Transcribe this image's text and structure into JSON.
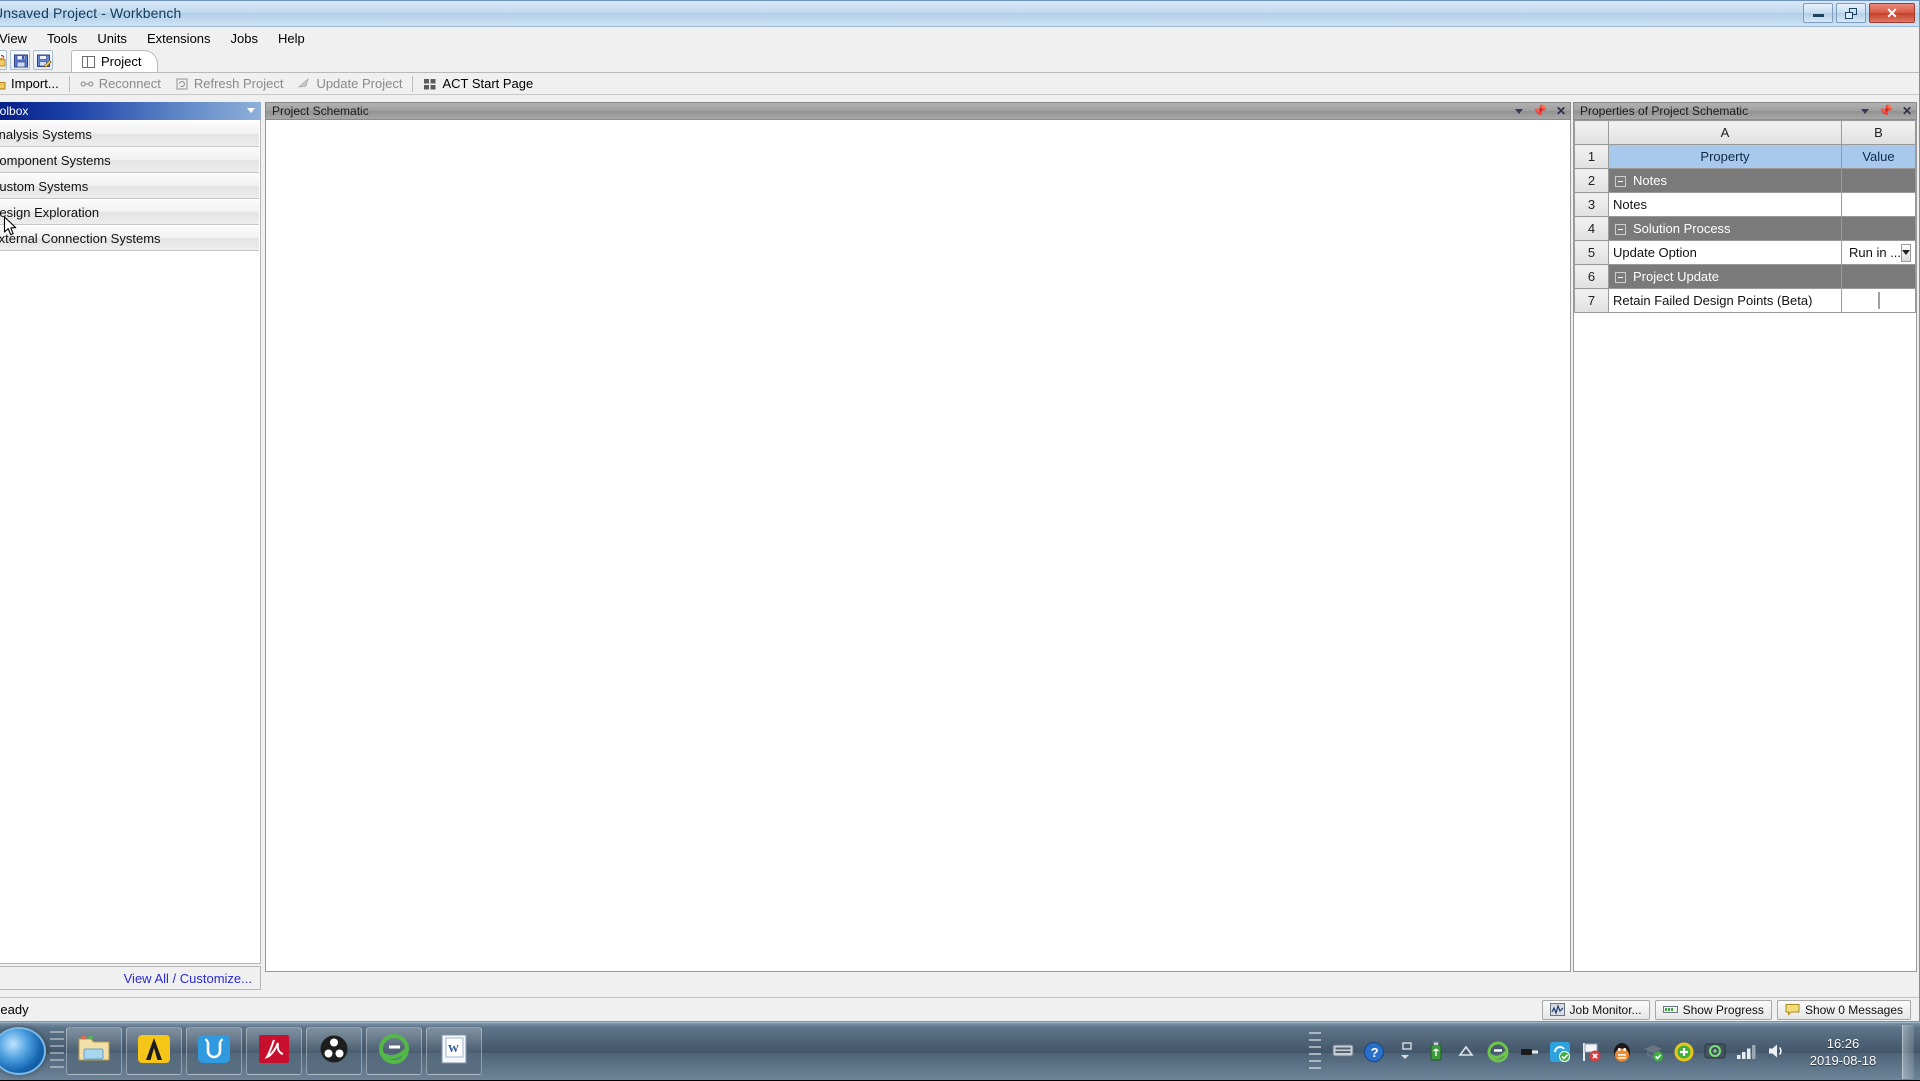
{
  "window": {
    "title": "Unsaved Project - Workbench",
    "controls": {
      "minimize": "minimize-button",
      "restore": "restore-button",
      "close": "close-button"
    }
  },
  "menu": {
    "items": [
      "View",
      "Tools",
      "Units",
      "Extensions",
      "Jobs",
      "Help"
    ]
  },
  "quick_toolbar": {
    "icons": [
      "open-folder-icon",
      "save-icon",
      "save-as-icon"
    ]
  },
  "tabs": [
    {
      "label": "Project",
      "icon": "project-layout-icon",
      "active": true
    }
  ],
  "command_bar": {
    "items": [
      {
        "label": "Import...",
        "icon": "import-icon",
        "enabled": true
      },
      {
        "label": "Reconnect",
        "icon": "reconnect-icon",
        "enabled": false
      },
      {
        "label": "Refresh Project",
        "icon": "refresh-icon",
        "enabled": false
      },
      {
        "label": "Update Project",
        "icon": "update-icon",
        "enabled": false
      },
      {
        "label": "ACT Start Page",
        "icon": "act-grid-icon",
        "enabled": true
      }
    ]
  },
  "toolbox": {
    "title": "Toolbox",
    "groups": [
      {
        "label": "Analysis Systems"
      },
      {
        "label": "Component Systems"
      },
      {
        "label": "Custom Systems"
      },
      {
        "label": "Design Exploration"
      },
      {
        "label": "External Connection Systems"
      }
    ],
    "footer_link": "View All / Customize..."
  },
  "schematic": {
    "title": "Project Schematic",
    "caption_buttons": [
      "dropdown-icon",
      "pin-icon",
      "close-icon"
    ]
  },
  "properties": {
    "title": "Properties of Project Schematic",
    "caption_buttons": [
      "dropdown-icon",
      "pin-icon",
      "close-icon"
    ],
    "columns": [
      "A",
      "B"
    ],
    "rows": [
      {
        "num": "1",
        "kind": "header",
        "a": "Property",
        "b": "Value"
      },
      {
        "num": "2",
        "kind": "group",
        "a": "Notes",
        "b": ""
      },
      {
        "num": "3",
        "kind": "prop",
        "a": "Notes",
        "b": "",
        "value_type": "text"
      },
      {
        "num": "4",
        "kind": "group",
        "a": "Solution Process",
        "b": ""
      },
      {
        "num": "5",
        "kind": "prop",
        "a": "Update Option",
        "b": "Run in ...",
        "value_type": "combo"
      },
      {
        "num": "6",
        "kind": "group",
        "a": "Project Update",
        "b": ""
      },
      {
        "num": "7",
        "kind": "prop",
        "a": "Retain Failed Design Points (Beta)",
        "b": "",
        "value_type": "checkbox",
        "checked": false
      }
    ]
  },
  "status_bar": {
    "text": "Ready",
    "buttons": [
      {
        "label": "Job Monitor...",
        "icon": "job-monitor-icon"
      },
      {
        "label": "Show Progress",
        "icon": "progress-icon"
      },
      {
        "label": "Show 0 Messages",
        "icon": "messages-icon"
      }
    ]
  },
  "taskbar": {
    "start": "start-orb-icon",
    "apps": [
      {
        "name": "file-explorer-icon"
      },
      {
        "name": "ansys-icon"
      },
      {
        "name": "utorrent-icon"
      },
      {
        "name": "adobe-acrobat-icon"
      },
      {
        "name": "obs-studio-icon"
      },
      {
        "name": "internet-explorer-icon"
      },
      {
        "name": "microsoft-word-icon"
      }
    ],
    "tray": [
      "keyboard-icon",
      "help-icon",
      "show-hidden-icon",
      "usb-safely-remove-icon",
      "arrow-up-icon",
      "internet-explorer-tray-icon",
      "usb-device-icon",
      "sync-icon",
      "flag-error-icon",
      "qq-icon",
      "graduation-icon",
      "plus-green-icon",
      "network-icon",
      "signal-icon",
      "volume-icon"
    ],
    "clock": {
      "time": "16:26",
      "date": "2019-08-18"
    }
  },
  "colors": {
    "title_gradient_start": "#d9e8f7",
    "toolbox_header_blue": "#00177e",
    "panel_caption_grey": "#9f9f9f",
    "table_header_blue": "#a8c8ec",
    "group_row_grey": "#7a7a7a",
    "link_blue": "#2a2ad0",
    "close_red": "#c2402c"
  }
}
